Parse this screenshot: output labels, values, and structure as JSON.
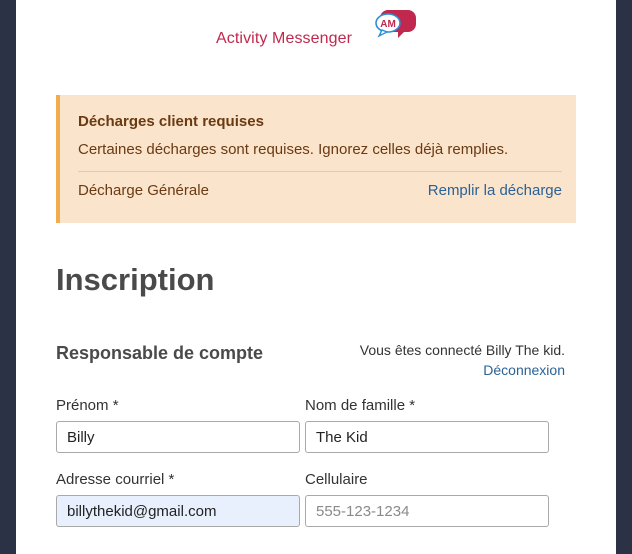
{
  "logo": {
    "text": "Activity Messenger",
    "badge": "AM",
    "colors": {
      "text": "#c0294d",
      "bubble_primary": "#c0294d",
      "bubble_secondary": "#2b8fd6"
    }
  },
  "alert": {
    "title": "Décharges client requises",
    "message": "Certaines décharges sont requises. Ignorez celles déjà remplies.",
    "waiver_name": "Décharge Générale",
    "waiver_action": "Remplir la décharge",
    "colors": {
      "background": "#fbe4cc",
      "border": "#f0ad4e",
      "text": "#6a3a12"
    }
  },
  "page": {
    "title": "Inscription"
  },
  "account_section": {
    "title": "Responsable de compte",
    "logged_in_text": "Vous êtes connecté Billy The kid.",
    "logout_label": "Déconnexion"
  },
  "form": {
    "first_name": {
      "label": "Prénom *",
      "value": "Billy"
    },
    "last_name": {
      "label": "Nom de famille *",
      "value": "The Kid"
    },
    "email": {
      "label": "Adresse courriel *",
      "value": "billythekid@gmail.com"
    },
    "mobile": {
      "label": "Cellulaire",
      "value": "",
      "placeholder": "555-123-1234"
    }
  },
  "colors": {
    "link": "#2b6296",
    "frame": "#2b3245",
    "autofill": "#e8f0fe"
  }
}
